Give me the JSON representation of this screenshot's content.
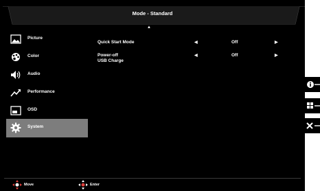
{
  "header": {
    "title": "Mode - Standard"
  },
  "sidebar": {
    "items": [
      {
        "label": "Picture",
        "icon": "picture-icon"
      },
      {
        "label": "Color",
        "icon": "color-icon"
      },
      {
        "label": "Audio",
        "icon": "speaker-icon"
      },
      {
        "label": "Performance",
        "icon": "performance-icon"
      },
      {
        "label": "OSD",
        "icon": "osd-icon"
      },
      {
        "label": "System",
        "icon": "gear-icon",
        "selected": true
      }
    ]
  },
  "settings": [
    {
      "label": "Quick Start Mode",
      "value": "Off"
    },
    {
      "label_line1": "Power-off",
      "label_line2": "USB Charge",
      "value": "Off"
    }
  ],
  "footer": {
    "move_label": "Move",
    "enter_label": "Enter"
  },
  "hardware_keys": [
    "info-icon",
    "grid-icon",
    "close-icon"
  ],
  "colors": {
    "background": "#000000",
    "selected": "#7d7d7d",
    "joystick_accent": "#e0403c"
  }
}
